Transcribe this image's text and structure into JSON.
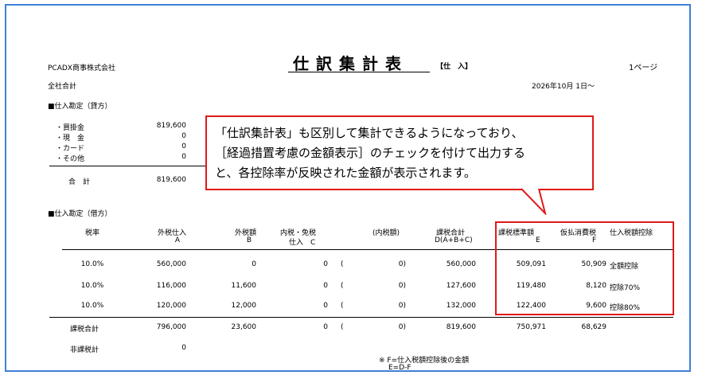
{
  "header": {
    "company": "PCADX商事株式会社",
    "title": "仕訳集計表",
    "subtitle": "【仕　入】",
    "page": "1ページ",
    "scope": "全社合計",
    "date": "2026年10月 1日～"
  },
  "credit_section": {
    "heading": "■仕入勘定（貸方）",
    "items": [
      {
        "label": "・買掛金",
        "value": "819,600"
      },
      {
        "label": "・現　金",
        "value": "0"
      },
      {
        "label": "・カード",
        "value": "0"
      },
      {
        "label": "・その他",
        "value": "0"
      }
    ],
    "total_label": "合　計",
    "total_value": "819,600"
  },
  "debit_section": {
    "heading": "■仕入勘定（借方）",
    "columns": {
      "rate": "税率",
      "a1": "外税仕入",
      "a2": "A",
      "b1": "外税額",
      "b2": "B",
      "c1": "内税・免税",
      "c2": "仕入　C",
      "inner": "(内税額)",
      "d1": "課税合計",
      "d2": "D(A+B+C)",
      "e1": "課税標準額",
      "e2": "E",
      "f1": "仮払消費税",
      "f2": "F",
      "g1": "仕入税額控除"
    },
    "rows": [
      {
        "rate": "10.0%",
        "a": "560,000",
        "b": "0",
        "c": "0",
        "paren": "(",
        "inner": "0)",
        "d": "560,000",
        "e": "509,091",
        "f": "50,909",
        "g": "全額控除"
      },
      {
        "rate": "10.0%",
        "a": "116,000",
        "b": "11,600",
        "c": "0",
        "paren": "(",
        "inner": "0)",
        "d": "127,600",
        "e": "119,480",
        "f": "8,120",
        "g": "控除70%"
      },
      {
        "rate": "10.0%",
        "a": "120,000",
        "b": "12,000",
        "c": "0",
        "paren": "(",
        "inner": "0)",
        "d": "132,000",
        "e": "122,400",
        "f": "9,600",
        "g": "控除80%"
      }
    ],
    "taxable_total": {
      "label": "課税合計",
      "a": "796,000",
      "b": "23,600",
      "c": "0",
      "paren": "(",
      "inner": "0)",
      "d": "819,600",
      "e": "750,971",
      "f": "68,629"
    },
    "nontaxable_total": {
      "label": "非課税計",
      "value": "0"
    },
    "note1": "※ F=仕入税額控除後の金額",
    "note2": "E=D-F"
  },
  "callout": {
    "line1": "「仕訳集計表」も区別して集計できるようになっており、",
    "line2": "［経過措置考慮の金額表示］のチェックを付けて出力する",
    "line3": "と、各控除率が反映された金額が表示されます。"
  },
  "colors": {
    "frame": "#3f7fd8",
    "highlight": "#e01919"
  }
}
